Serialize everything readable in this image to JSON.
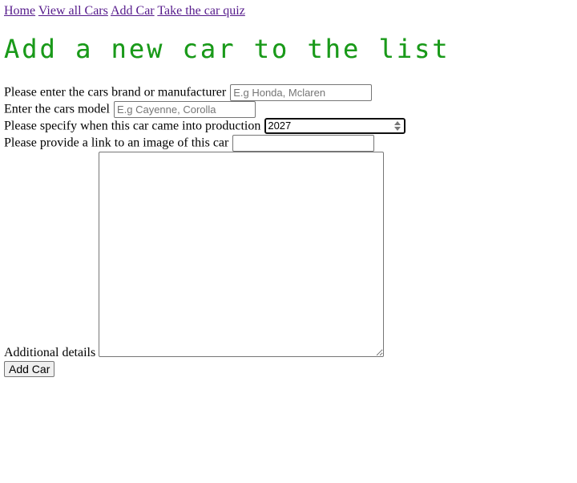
{
  "nav": {
    "links": [
      "Home",
      "View all Cars",
      "Add Car",
      "Take the car quiz"
    ]
  },
  "heading": "Add a new car to the list",
  "colors": {
    "heading": "#1a9a1a",
    "link_visited": "#551a8b"
  },
  "form": {
    "brand": {
      "label": "Please enter the cars brand or manufacturer",
      "placeholder": "E.g Honda, Mclaren",
      "value": ""
    },
    "model": {
      "label": "Enter the cars model",
      "placeholder": "E.g Cayenne, Corolla",
      "value": ""
    },
    "year": {
      "label": "Please specify when this car came into production",
      "value": "2027"
    },
    "image": {
      "label": "Please provide a link to an image of this car",
      "value": ""
    },
    "details": {
      "label": "Additional details",
      "value": ""
    },
    "submit_label": "Add Car"
  }
}
